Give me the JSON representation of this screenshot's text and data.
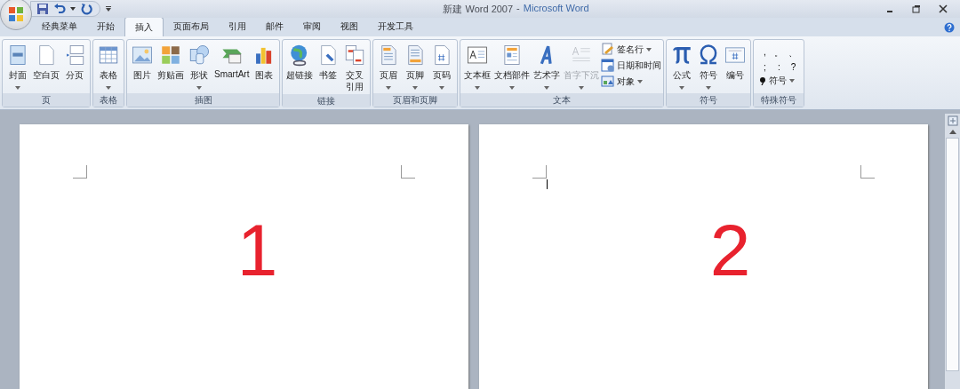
{
  "title_bar": {
    "document": "新建 Word 2007",
    "separator": "-",
    "application": "Microsoft Word"
  },
  "tabs": [
    {
      "label": "经典菜单",
      "selected": false
    },
    {
      "label": "开始",
      "selected": false
    },
    {
      "label": "插入",
      "selected": true
    },
    {
      "label": "页面布局",
      "selected": false
    },
    {
      "label": "引用",
      "selected": false
    },
    {
      "label": "邮件",
      "selected": false
    },
    {
      "label": "审阅",
      "selected": false
    },
    {
      "label": "视图",
      "selected": false
    },
    {
      "label": "开发工具",
      "selected": false
    }
  ],
  "groups": [
    {
      "name": "页",
      "items": [
        {
          "kind": "large",
          "label": "封面",
          "dropdown": true
        },
        {
          "kind": "large",
          "label": "空白页",
          "dropdown": false
        },
        {
          "kind": "large",
          "label": "分页",
          "dropdown": false
        }
      ]
    },
    {
      "name": "表格",
      "items": [
        {
          "kind": "large",
          "label": "表格",
          "dropdown": true
        }
      ]
    },
    {
      "name": "插图",
      "items": [
        {
          "kind": "large",
          "label": "图片",
          "dropdown": false
        },
        {
          "kind": "large",
          "label": "剪贴画",
          "dropdown": false
        },
        {
          "kind": "large",
          "label": "形状",
          "dropdown": true
        },
        {
          "kind": "large",
          "label": "SmartArt",
          "dropdown": false
        },
        {
          "kind": "large",
          "label": "图表",
          "dropdown": false
        }
      ]
    },
    {
      "name": "链接",
      "items": [
        {
          "kind": "large",
          "label": "超链接",
          "dropdown": false
        },
        {
          "kind": "large",
          "label": "书签",
          "dropdown": false
        },
        {
          "kind": "large",
          "label": "交叉引用",
          "wrap": true,
          "dropdown": false
        }
      ]
    },
    {
      "name": "页眉和页脚",
      "items": [
        {
          "kind": "large",
          "label": "页眉",
          "dropdown": true
        },
        {
          "kind": "large",
          "label": "页脚",
          "dropdown": true
        },
        {
          "kind": "large",
          "label": "页码",
          "dropdown": true
        }
      ]
    },
    {
      "name": "文本",
      "items": [
        {
          "kind": "large",
          "label": "文本框",
          "dropdown": true
        },
        {
          "kind": "large",
          "label": "文档部件",
          "dropdown": true
        },
        {
          "kind": "large",
          "label": "艺术字",
          "dropdown": true
        },
        {
          "kind": "large",
          "label": "首字下沉",
          "dropdown": true,
          "disabled": true
        },
        {
          "kind": "small",
          "entries": [
            {
              "label": "签名行",
              "dropdown": true
            },
            {
              "label": "日期和时间",
              "dropdown": false
            },
            {
              "label": "对象",
              "dropdown": true
            }
          ]
        }
      ]
    },
    {
      "name": "符号",
      "items": [
        {
          "kind": "large",
          "label": "公式",
          "dropdown": true
        },
        {
          "kind": "large",
          "label": "符号",
          "dropdown": true
        },
        {
          "kind": "large",
          "label": "编号",
          "dropdown": false
        }
      ]
    },
    {
      "name": "特殊符号",
      "items": [
        {
          "kind": "symbols",
          "marks": [
            ",",
            "。",
            "、",
            ";",
            ":",
            "?"
          ],
          "button": {
            "label": "符号",
            "dropdown": true
          }
        }
      ]
    }
  ],
  "pages": [
    {
      "mark": "1",
      "cursor": false
    },
    {
      "mark": "2",
      "cursor": true
    }
  ]
}
